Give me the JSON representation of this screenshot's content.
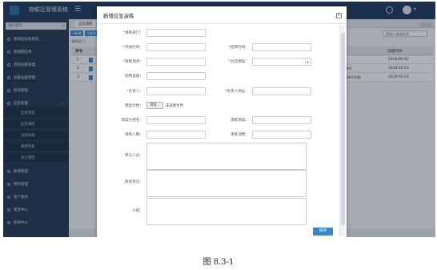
{
  "app": {
    "title": "物联区管理系统",
    "menu_icon": "menu-icon",
    "top_icons": [
      "settings-icon",
      "user-icon"
    ]
  },
  "sidebar": {
    "search_placeholder": "搜索菜单...",
    "items": [
      {
        "label": "物联园设备管理",
        "icon": "circle-icon"
      },
      {
        "label": "物联网应用",
        "icon": "circle-icon"
      },
      {
        "label": "消防设备管理",
        "icon": "circle-icon"
      },
      {
        "label": "设备设施管理",
        "icon": "circle-icon"
      },
      {
        "label": "巡检管理",
        "icon": "circle-icon"
      },
      {
        "label": "应急管理",
        "icon": "circle-icon"
      }
    ],
    "subitems": [
      "应急预案",
      "应急演练",
      "法律法规",
      "隐患排查",
      "安全制度"
    ],
    "items_after": [
      {
        "label": "能耗管理",
        "icon": "circle-icon"
      },
      {
        "label": "物料管理",
        "icon": "circle-icon"
      },
      {
        "label": "客户服务",
        "icon": "circle-icon"
      },
      {
        "label": "租赁中心",
        "icon": "circle-icon"
      },
      {
        "label": "招商中心",
        "icon": "circle-icon"
      }
    ]
  },
  "main": {
    "tab": "应急演练",
    "toolbar": [
      "+新增",
      "Q查询"
    ],
    "breadline": "演练部门:",
    "search_placeholder": "请输入查询条件",
    "table": {
      "header_index": "序号",
      "header_date": "创建时间",
      "rows": [
        {
          "num": "1",
          "loc": "",
          "date": "2018-06-02"
        },
        {
          "num": "2",
          "loc": "通88号",
          "date": "2018-05-03"
        },
        {
          "num": "3",
          "loc": "江388号检察",
          "date": "2018-05-03"
        }
      ]
    }
  },
  "modal": {
    "title": "新增应急演练",
    "close": "×",
    "fields": {
      "dept": "*演练部门：",
      "start": "*开始时间：",
      "end": "*结束时间：",
      "place": "*演练地点：",
      "plan": "*对应预案：",
      "equip": "动用设备：",
      "leader": "*负责人：",
      "leader_addr": "*负责人地址：",
      "doc": "预案文档：",
      "browse": "浏览...",
      "nofile": "未选择文件",
      "doc_name": "预案文档名：",
      "plan_name": "演练预案：",
      "people_count": "演练人数：",
      "expense": "演练消费：",
      "participants": "参与人员：",
      "improve": "改进意见：",
      "summary": "小结："
    },
    "save": "保存"
  },
  "caption": "图 8.3-1"
}
